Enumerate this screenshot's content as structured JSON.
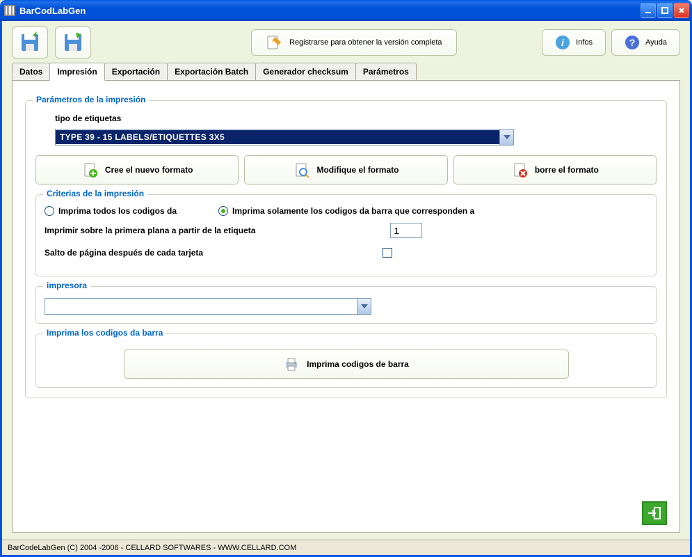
{
  "window": {
    "title": "BarCodLabGen"
  },
  "toolbar": {
    "register_label": "Registrarse para obtener la versión completa",
    "infos_label": "Infos",
    "help_label": "Ayuda"
  },
  "tabs": [
    "Datos",
    "Impresión",
    "Exportación",
    "Exportación Batch",
    "Generador checksum",
    "Parámetros"
  ],
  "active_tab": 1,
  "print_params": {
    "legend": "Parámetros de la impresión",
    "label_type_label": "tipo de etiquetas",
    "label_type_value": "TYPE 39 - 15 LABELS/ETIQUETTES 3X5",
    "create_format_label": "Cree el nuevo formato",
    "modify_format_label": "Modifique el formato",
    "delete_format_label": "borre el formato"
  },
  "criteria": {
    "legend": "Criterias de la impresión",
    "radio_all": "Imprima todos los codigos da",
    "radio_only": "Imprima solamente los codigos da barra que corresponden a",
    "radio_selected": "only",
    "first_page_label": "Imprimir sobre la primera plana a partir de la etiqueta",
    "first_page_value": "1",
    "page_break_label": "Salto de página después de cada tarjeta",
    "page_break_checked": false
  },
  "printer": {
    "legend": "impresora",
    "value": ""
  },
  "print_section": {
    "legend": "Imprima los codigos da barra",
    "button_label": "Imprima codigos de barra"
  },
  "statusbar": "BarCodeLabGen (C) 2004 -2006 - CELLARD SOFTWARES - WWW.CELLARD.COM"
}
